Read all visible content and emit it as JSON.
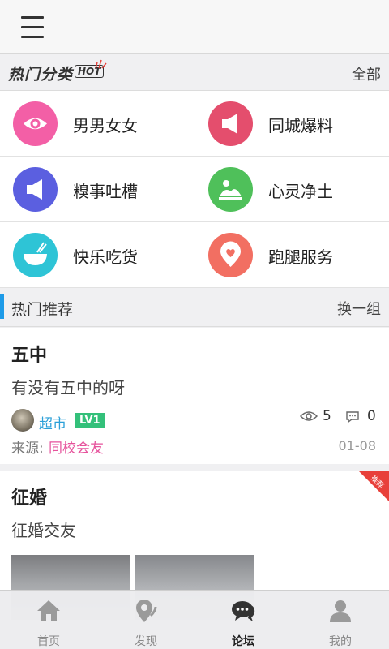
{
  "topbar": {
    "menu_icon": "hamburger-icon"
  },
  "hot": {
    "title": "热门分类",
    "badge": "HOT",
    "all_label": "全部"
  },
  "categories": [
    {
      "label": "男男女女",
      "icon": "eye-icon",
      "color": "#f35fa6"
    },
    {
      "label": "同城爆料",
      "icon": "megaphone-icon",
      "color": "#e44e6d"
    },
    {
      "label": "糗事吐槽",
      "icon": "megaphone-icon",
      "color": "#5b5fe0"
    },
    {
      "label": "心灵净土",
      "icon": "cloud-landscape-icon",
      "color": "#4fc05a"
    },
    {
      "label": "快乐吃货",
      "icon": "bowl-icon",
      "color": "#2ec4d6"
    },
    {
      "label": "跑腿服务",
      "icon": "location-heart-icon",
      "color": "#f26f62"
    }
  ],
  "recommend": {
    "title": "热门推荐",
    "switch_label": "换一组"
  },
  "posts": [
    {
      "title": "五中",
      "body": "有没有五中的呀",
      "author": "超市",
      "level": "LV1",
      "views": "5",
      "comments": "0",
      "source_label": "来源:",
      "source": "同校会友",
      "date": "01-08"
    },
    {
      "title": "征婚",
      "body": "征婚交友",
      "ribbon": "推荐"
    }
  ],
  "tabs": [
    {
      "label": "首页",
      "icon": "home-icon"
    },
    {
      "label": "发现",
      "icon": "location-pin-icon"
    },
    {
      "label": "论坛",
      "icon": "chat-bubbles-icon",
      "active": true
    },
    {
      "label": "我的",
      "icon": "user-icon"
    }
  ],
  "colors": {
    "accent": "#1e9be8",
    "author": "#2a9fd8",
    "level": "#33c07a",
    "source": "#e6529c",
    "ribbon": "#e8403a"
  }
}
